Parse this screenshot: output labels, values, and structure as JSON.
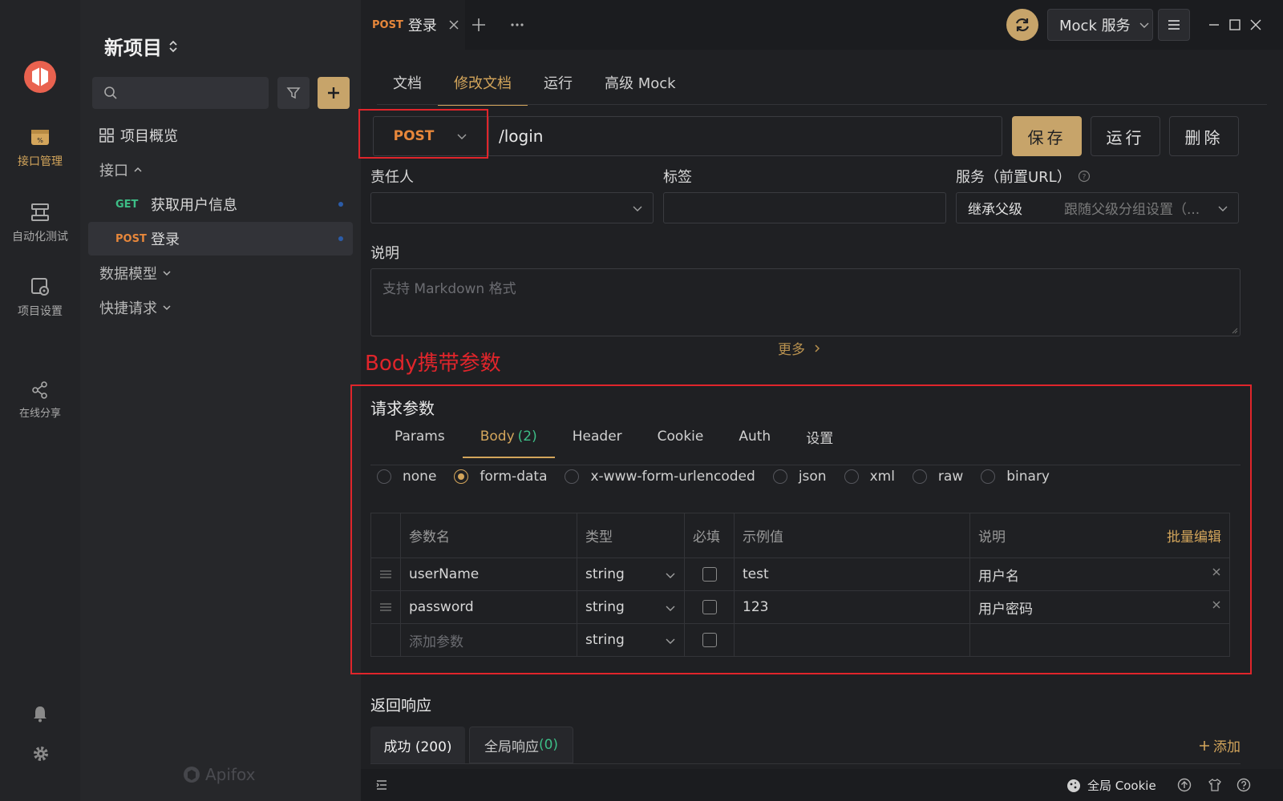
{
  "rail": {
    "items": [
      {
        "label": "接口管理",
        "active": true
      },
      {
        "label": "自动化测试",
        "active": false
      },
      {
        "label": "项目设置",
        "active": false
      },
      {
        "label": "在线分享",
        "active": false
      }
    ]
  },
  "tree": {
    "project_title": "新项目",
    "overview": "项目概览",
    "api_group": "接口",
    "apis": [
      {
        "method": "GET",
        "name": "获取用户信息"
      },
      {
        "method": "POST",
        "name": "登录"
      }
    ],
    "data_models": "数据模型",
    "quick_requests": "快捷请求",
    "watermark": "Apifox"
  },
  "tabbar": {
    "tab_method": "POST",
    "tab_name": "登录",
    "mock_service": "Mock 服务"
  },
  "subtabs": [
    "文档",
    "修改文档",
    "运行",
    "高级 Mock"
  ],
  "request": {
    "method": "POST",
    "path": "/login",
    "save": "保存",
    "run": "运行",
    "delete": "删除"
  },
  "fields": {
    "owner_label": "责任人",
    "tags_label": "标签",
    "service_label": "服务（前置URL）",
    "service_value": "继承父级",
    "service_hint": "跟随父级分组设置（...",
    "desc_label": "说明",
    "desc_placeholder": "支持 Markdown 格式",
    "more": "更多"
  },
  "annotation": "Body携带参数",
  "params_section": {
    "title": "请求参数",
    "tabs": [
      "Params",
      "Body",
      "Header",
      "Cookie",
      "Auth",
      "设置"
    ],
    "body_count": "(2)",
    "body_types": [
      "none",
      "form-data",
      "x-www-form-urlencoded",
      "json",
      "xml",
      "raw",
      "binary"
    ],
    "selected_body_type": "form-data",
    "columns": [
      "参数名",
      "类型",
      "必填",
      "示例值",
      "说明"
    ],
    "bulk_edit": "批量编辑",
    "rows": [
      {
        "name": "userName",
        "type": "string",
        "example": "test",
        "desc": "用户名"
      },
      {
        "name": "password",
        "type": "string",
        "example": "123",
        "desc": "用户密码"
      }
    ],
    "add_placeholder": "添加参数",
    "add_type": "string"
  },
  "response": {
    "title": "返回响应",
    "tab_success": "成功 (200)",
    "tab_global": "全局响应",
    "tab_global_count": "(0)",
    "add": "添加"
  },
  "statusbar": {
    "cookie": "全局 Cookie"
  },
  "colors": {
    "accent": "#d3a55b",
    "get": "#3dbd86",
    "post": "#e7873b",
    "annotation_red": "#e0252b"
  }
}
